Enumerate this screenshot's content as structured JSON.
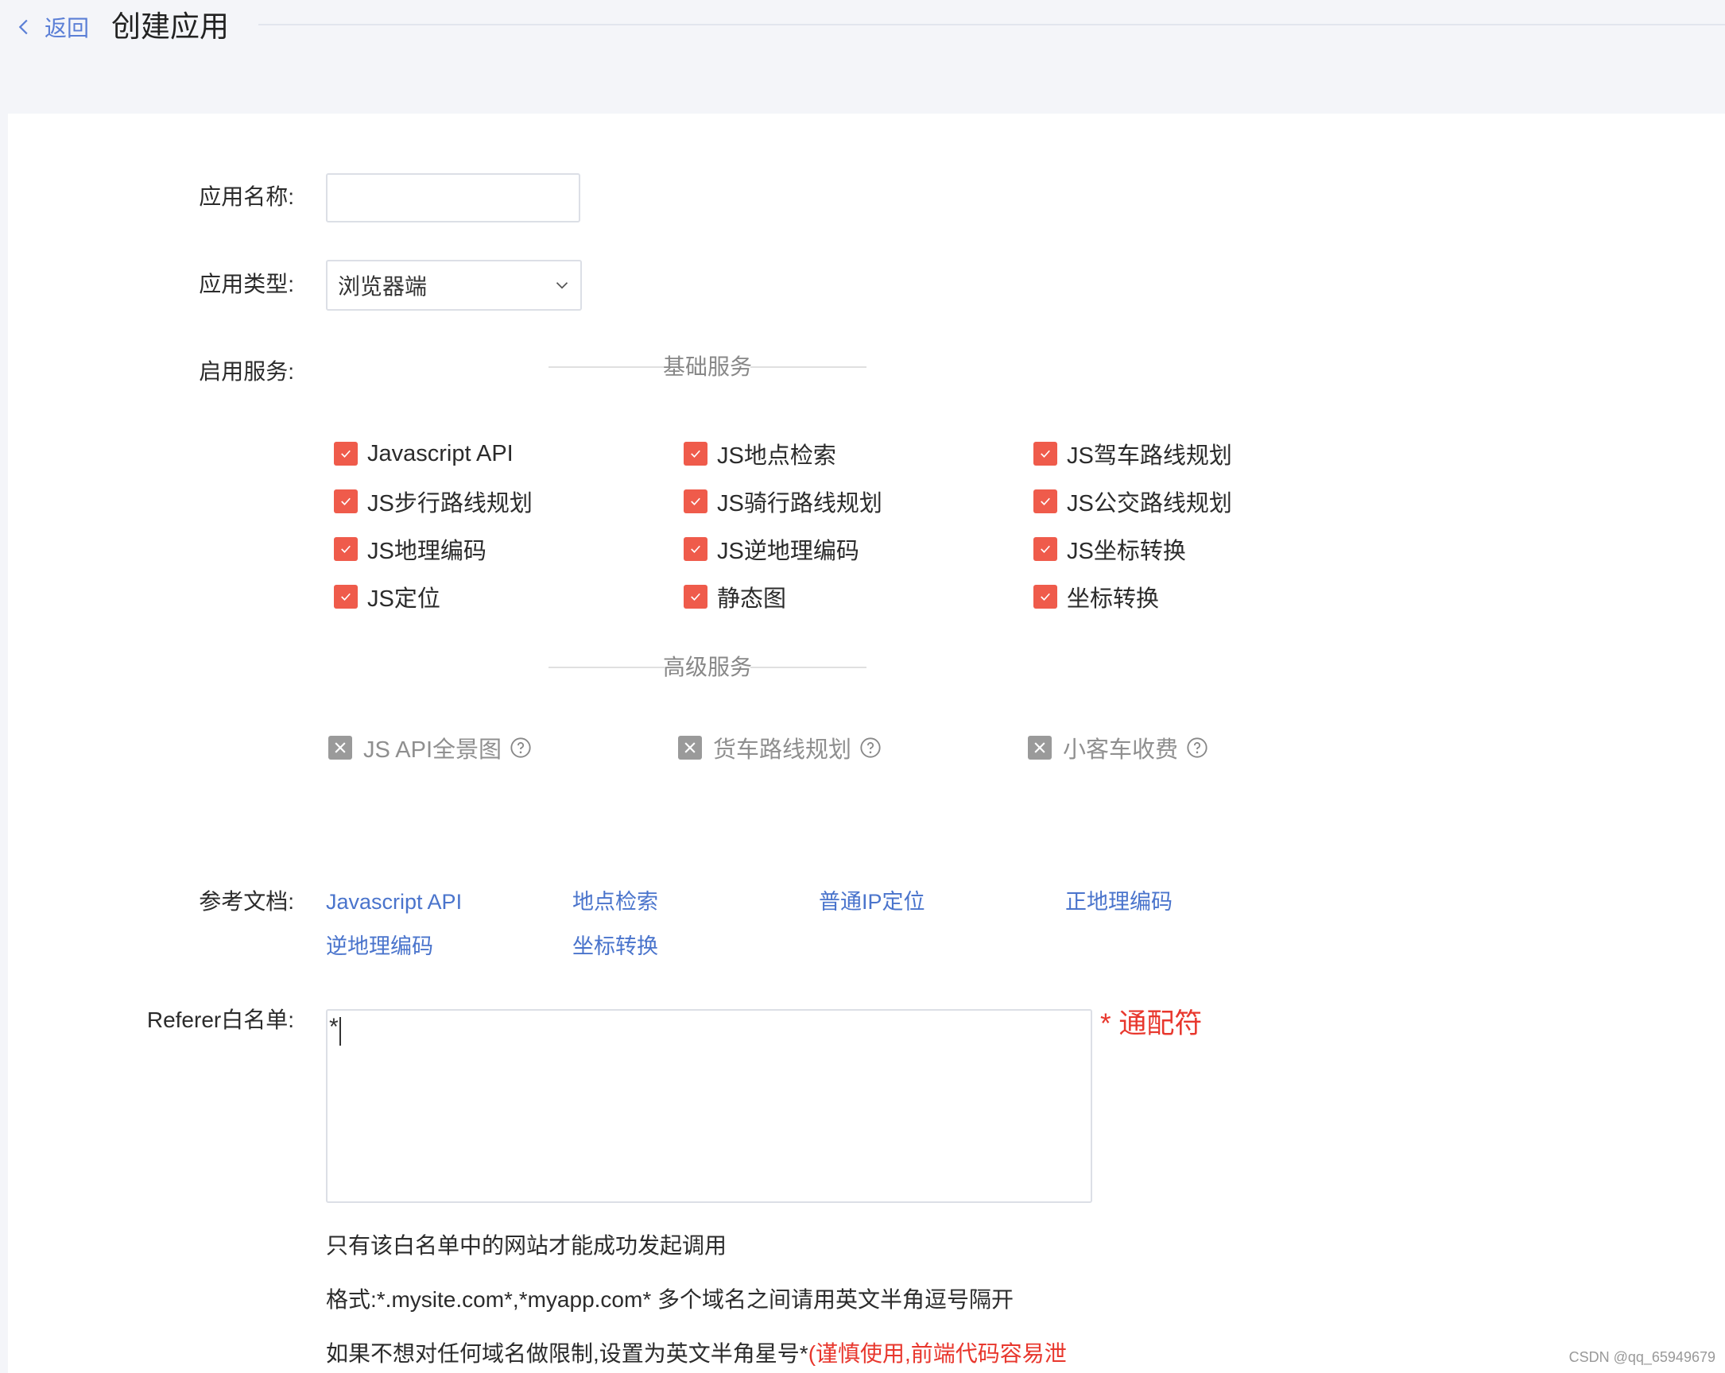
{
  "header": {
    "back_label": "返回",
    "title": "创建应用"
  },
  "form": {
    "app_name_label": "应用名称:",
    "app_name_value": "",
    "app_type_label": "应用类型:",
    "app_type_value": "浏览器端",
    "services_label": "启用服务:",
    "basic_services_title": "基础服务",
    "basic_services": [
      {
        "label": "Javascript API",
        "checked": true
      },
      {
        "label": "JS地点检索",
        "checked": true
      },
      {
        "label": "JS驾车路线规划",
        "checked": true
      },
      {
        "label": "JS步行路线规划",
        "checked": true
      },
      {
        "label": "JS骑行路线规划",
        "checked": true
      },
      {
        "label": "JS公交路线规划",
        "checked": true
      },
      {
        "label": "JS地理编码",
        "checked": true
      },
      {
        "label": "JS逆地理编码",
        "checked": true
      },
      {
        "label": "JS坐标转换",
        "checked": true
      },
      {
        "label": "JS定位",
        "checked": true
      },
      {
        "label": "静态图",
        "checked": true
      },
      {
        "label": "坐标转换",
        "checked": true
      }
    ],
    "advanced_services_title": "高级服务",
    "advanced_services": [
      {
        "label": "JS API全景图",
        "enabled": false
      },
      {
        "label": "货车路线规划",
        "enabled": false
      },
      {
        "label": "小客车收费",
        "enabled": false
      }
    ],
    "docs_label": "参考文档:",
    "docs": [
      "Javascript API",
      "地点检索",
      "普通IP定位",
      "正地理编码",
      "逆地理编码",
      "坐标转换"
    ],
    "referer_label": "Referer白名单:",
    "referer_value": "*",
    "wildcard_note": "* 通配符",
    "note_1": "只有该白名单中的网站才能成功发起调用",
    "note_2": "格式:*.mysite.com*,*myapp.com* 多个域名之间请用英文半角逗号隔开",
    "note_3_prefix": "如果不想对任何域名做限制,设置为英文半角星号*",
    "note_3_warning": "(谨慎使用,前端代码容易泄"
  },
  "watermark": "CSDN @qq_65949679",
  "colors": {
    "checkbox_checked": "#ef5b4b",
    "checkbox_disabled": "#9a9a9a",
    "link": "#4a74cc",
    "warning": "#e8372d",
    "page_bg": "#f4f5f9"
  },
  "icons": {
    "back": "chevron-left-icon",
    "select": "chevron-down-icon",
    "checked": "check-icon",
    "disabled": "x-icon",
    "help": "question-circle-icon"
  }
}
